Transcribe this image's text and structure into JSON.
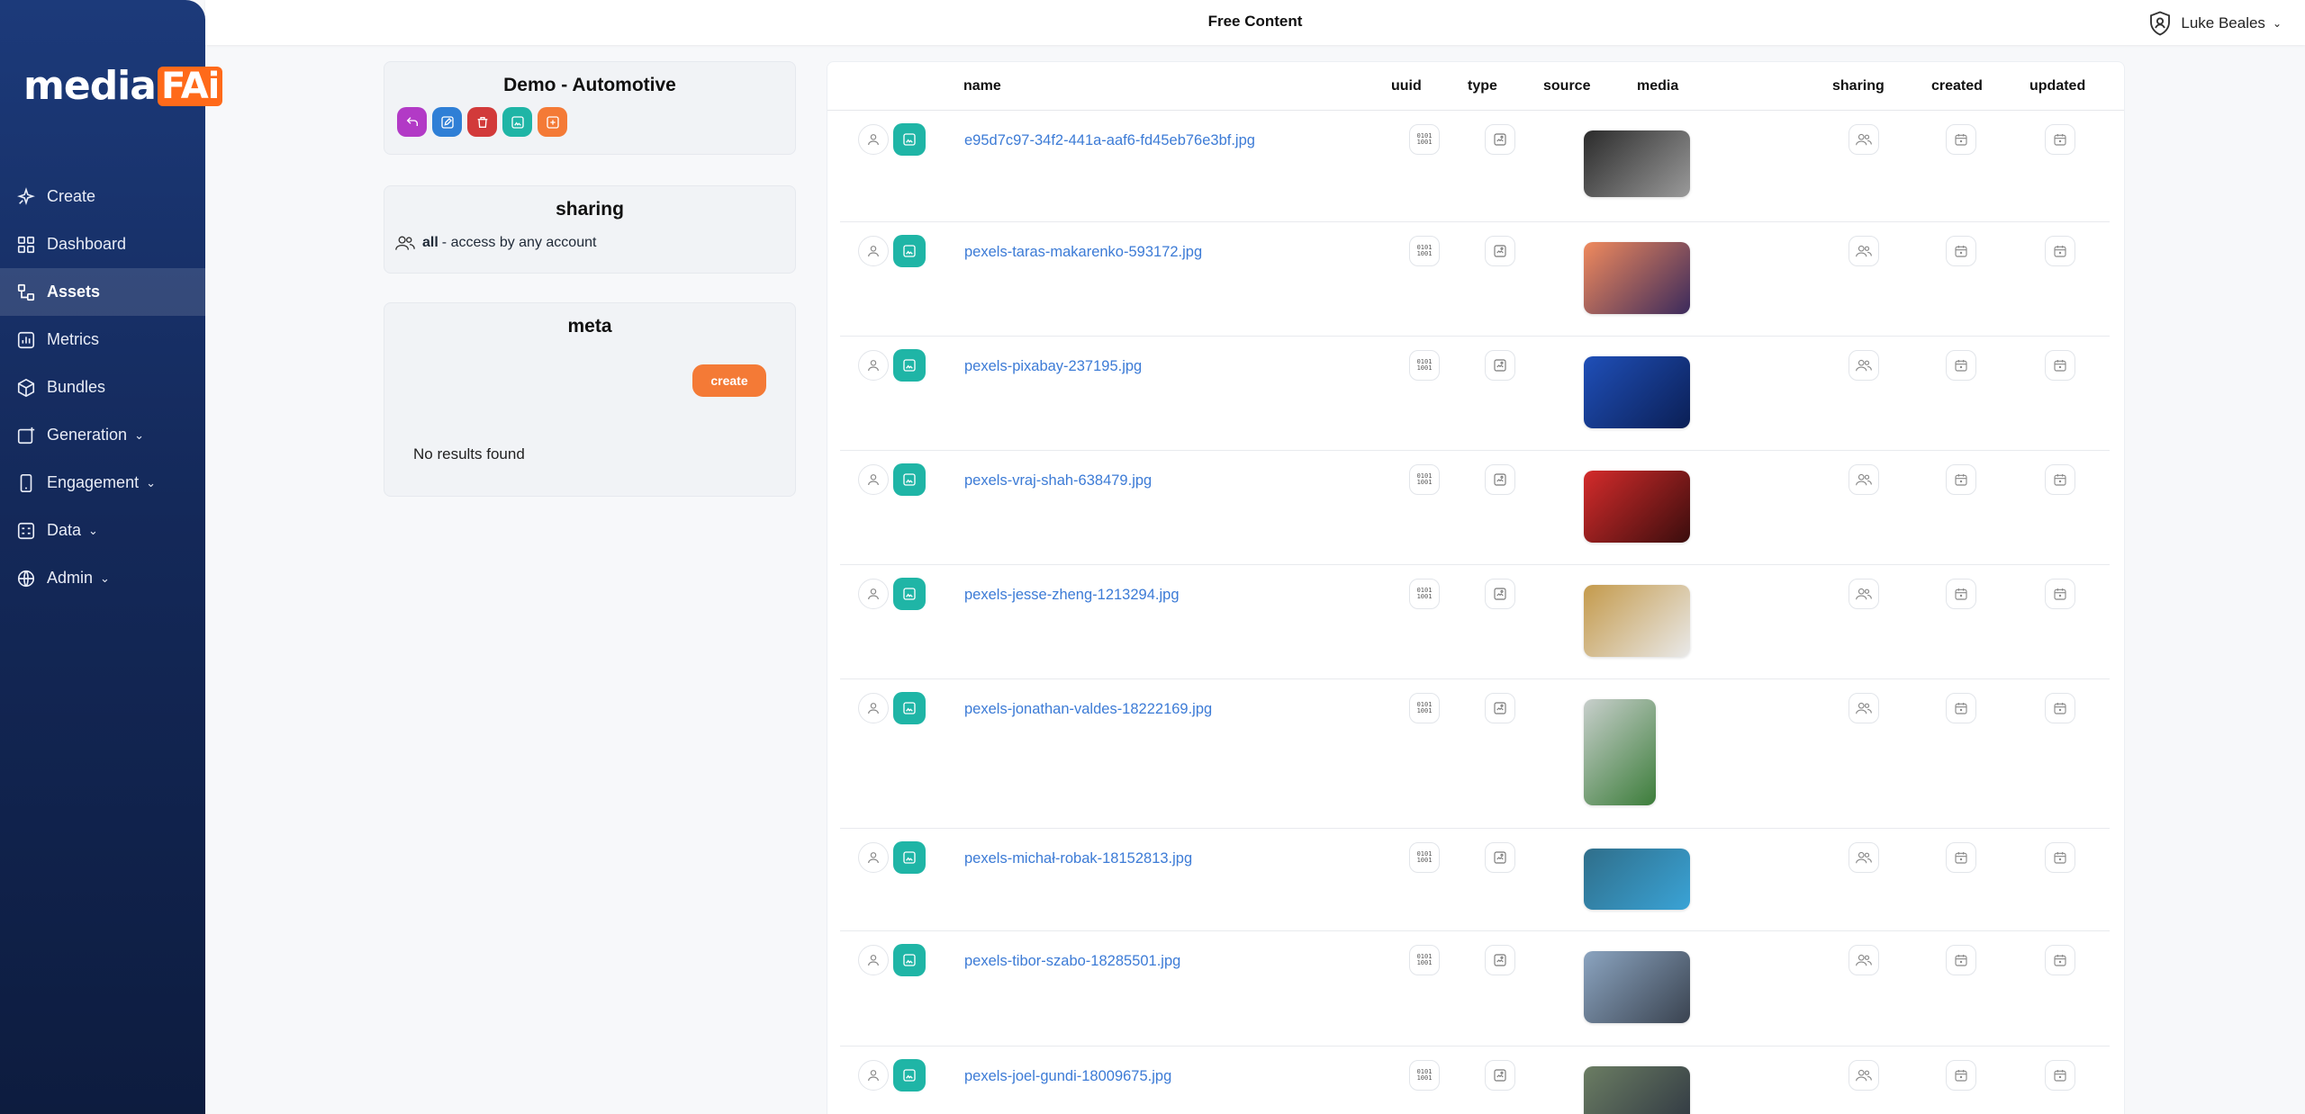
{
  "app": {
    "logo_text": "media",
    "logo_accent": "FAi",
    "page_title": "Free Content",
    "user_name": "Luke Beales"
  },
  "sidebar": {
    "items": [
      {
        "label": "Create",
        "icon": "sparkle-icon"
      },
      {
        "label": "Dashboard",
        "icon": "grid-icon"
      },
      {
        "label": "Assets",
        "icon": "assets-icon",
        "active": true
      },
      {
        "label": "Metrics",
        "icon": "chart-icon"
      },
      {
        "label": "Bundles",
        "icon": "box-icon"
      },
      {
        "label": "Generation",
        "icon": "add-image-icon",
        "dropdown": true
      },
      {
        "label": "Engagement",
        "icon": "phone-icon",
        "dropdown": true
      },
      {
        "label": "Data",
        "icon": "data-icon",
        "dropdown": true
      },
      {
        "label": "Admin",
        "icon": "globe-icon",
        "dropdown": true
      }
    ]
  },
  "bundle_card": {
    "title": "Demo - Automotive",
    "action_colors": [
      "#b23ac6",
      "#2f7fd6",
      "#d23a3a",
      "#1fb5a6",
      "#f47a36"
    ]
  },
  "sharing_card": {
    "title": "sharing",
    "value": "all",
    "description": "- access by any account"
  },
  "meta_card": {
    "title": "meta",
    "create_label": "create",
    "empty_text": "No results found"
  },
  "table": {
    "columns": {
      "name": "name",
      "uuid": "uuid",
      "type": "type",
      "source": "source",
      "media": "media",
      "sharing": "sharing",
      "created": "created",
      "updated": "updated"
    },
    "rows": [
      {
        "name": "e95d7c97-34f2-441a-aaf6-fd45eb76e3bf.jpg",
        "colors": [
          "#2b2b2b",
          "#9a9a9a"
        ]
      },
      {
        "name": "pexels-taras-makarenko-593172.jpg",
        "colors": [
          "#f08a5d",
          "#3b2a5c"
        ]
      },
      {
        "name": "pexels-pixabay-237195.jpg",
        "colors": [
          "#1f4fb8",
          "#0b1f55"
        ]
      },
      {
        "name": "pexels-vraj-shah-638479.jpg",
        "colors": [
          "#d42b2b",
          "#3a0d0d"
        ]
      },
      {
        "name": "pexels-jesse-zheng-1213294.jpg",
        "colors": [
          "#c49a4b",
          "#e9e9e9"
        ]
      },
      {
        "name": "pexels-jonathan-valdes-18222169.jpg",
        "colors": [
          "#c8cfcc",
          "#3c7d3a"
        ]
      },
      {
        "name": "pexels-michał-robak-18152813.jpg",
        "colors": [
          "#2f6e8a",
          "#3aa3d6"
        ]
      },
      {
        "name": "pexels-tibor-szabo-18285501.jpg",
        "colors": [
          "#8ba4c0",
          "#3a4350"
        ]
      },
      {
        "name": "pexels-joel-gundi-18009675.jpg",
        "colors": [
          "#6b7d63",
          "#2c3340"
        ]
      }
    ]
  }
}
